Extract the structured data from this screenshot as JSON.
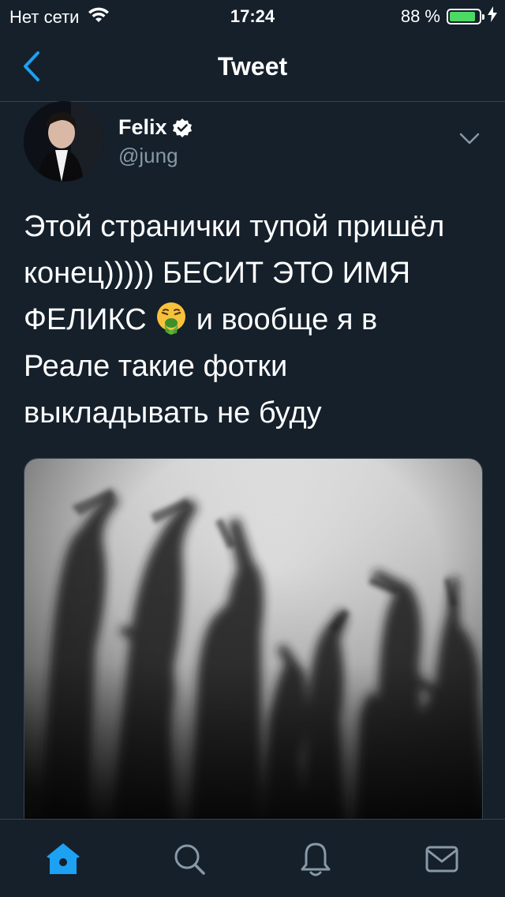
{
  "status_bar": {
    "carrier": "Нет сети",
    "time": "17:24",
    "battery_percent": "88 %",
    "battery_level": 0.88,
    "icons": [
      "wifi-icon",
      "battery-icon",
      "charging-icon"
    ]
  },
  "header": {
    "title": "Tweet",
    "back_icon": "chevron-left-icon"
  },
  "tweet": {
    "author_name": "Felix",
    "author_handle": "@jung",
    "verified": true,
    "text_line1": "Этой странички тупой пришёл",
    "text_line2": "конец))))) БЕСИТ ЭТО ИМЯ",
    "text_line3_a": "ФЕЛИКС ",
    "text_line3_b": " и вообще я в",
    "text_line4": "Реале такие фотки",
    "text_line5": "выкладывать не буду",
    "emoji": "face-vomiting-emoji",
    "media": "photo of hands showing middle fingers behind frosted glass"
  },
  "tab_bar": {
    "items": [
      "home-icon",
      "search-icon",
      "notifications-icon",
      "messages-icon"
    ],
    "active": "home-icon"
  },
  "colors": {
    "background": "#15202b",
    "accent": "#1da1f2",
    "secondary_text": "#8899a6",
    "divider": "#38444d",
    "battery": "#4cd964"
  }
}
